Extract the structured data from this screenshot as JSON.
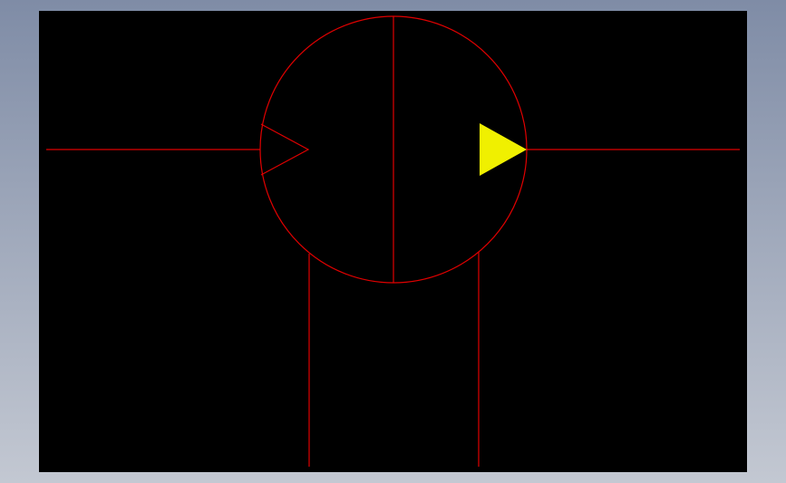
{
  "colors": {
    "backdrop_top": "#7f8ca6",
    "backdrop_bottom": "#c3c8d2",
    "canvas_background": "#000000",
    "line": "#e00000",
    "arrow_fill": "#f0f000"
  },
  "diagram": {
    "symbol": "hydraulic-pump-motor-circle",
    "elements": [
      "flow-line-left",
      "symbol-circle",
      "divider-line",
      "inlet-arrow-outline",
      "outlet-arrow-filled",
      "flow-line-right",
      "port-line-left",
      "port-line-right"
    ]
  }
}
